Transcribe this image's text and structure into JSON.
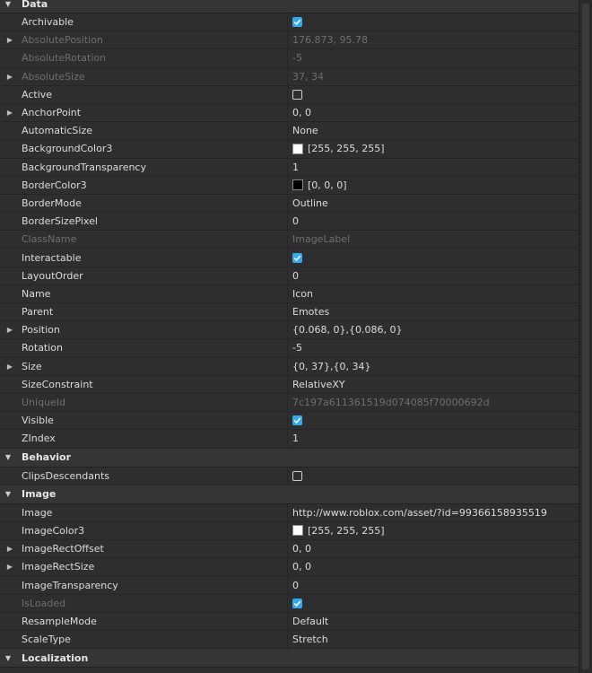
{
  "colors": {
    "check_on": "#35a9f0",
    "white": "#ffffff",
    "black": "#000000"
  },
  "sections": {
    "data": "Data",
    "behavior": "Behavior",
    "image": "Image",
    "localization": "Localization"
  },
  "props": {
    "archivable": {
      "name": "Archivable",
      "checked": true
    },
    "absolute_position": {
      "name": "AbsolutePosition",
      "value": "176.873, 95.78"
    },
    "absolute_rotation": {
      "name": "AbsoluteRotation",
      "value": "-5"
    },
    "absolute_size": {
      "name": "AbsoluteSize",
      "value": "37, 34"
    },
    "active": {
      "name": "Active",
      "checked": false
    },
    "anchor_point": {
      "name": "AnchorPoint",
      "value": "0, 0"
    },
    "automatic_size": {
      "name": "AutomaticSize",
      "value": "None"
    },
    "background_color3": {
      "name": "BackgroundColor3",
      "value": "[255, 255, 255]"
    },
    "background_transparency": {
      "name": "BackgroundTransparency",
      "value": "1"
    },
    "border_color3": {
      "name": "BorderColor3",
      "value": "[0, 0, 0]"
    },
    "border_mode": {
      "name": "BorderMode",
      "value": "Outline"
    },
    "border_size_pixel": {
      "name": "BorderSizePixel",
      "value": "0"
    },
    "class_name": {
      "name": "ClassName",
      "value": "ImageLabel"
    },
    "interactable": {
      "name": "Interactable",
      "checked": true
    },
    "layout_order": {
      "name": "LayoutOrder",
      "value": "0"
    },
    "name_prop": {
      "name": "Name",
      "value": "Icon"
    },
    "parent": {
      "name": "Parent",
      "value": "Emotes"
    },
    "position": {
      "name": "Position",
      "value": "{0.068, 0},{0.086, 0}"
    },
    "rotation": {
      "name": "Rotation",
      "value": "-5"
    },
    "size": {
      "name": "Size",
      "value": "{0, 37},{0, 34}"
    },
    "size_constraint": {
      "name": "SizeConstraint",
      "value": "RelativeXY"
    },
    "unique_id": {
      "name": "UniqueId",
      "value": "7c197a611361519d074085f70000692d"
    },
    "visible": {
      "name": "Visible",
      "checked": true
    },
    "zindex": {
      "name": "ZIndex",
      "value": "1"
    },
    "clips_descendants": {
      "name": "ClipsDescendants",
      "checked": false
    },
    "image": {
      "name": "Image",
      "value": "http://www.roblox.com/asset/?id=99366158935519"
    },
    "image_color3": {
      "name": "ImageColor3",
      "value": "[255, 255, 255]"
    },
    "image_rect_offset": {
      "name": "ImageRectOffset",
      "value": "0, 0"
    },
    "image_rect_size": {
      "name": "ImageRectSize",
      "value": "0, 0"
    },
    "image_transparency": {
      "name": "ImageTransparency",
      "value": "0"
    },
    "is_loaded": {
      "name": "IsLoaded",
      "checked": true
    },
    "resample_mode": {
      "name": "ResampleMode",
      "value": "Default"
    },
    "scale_type": {
      "name": "ScaleType",
      "value": "Stretch"
    }
  }
}
